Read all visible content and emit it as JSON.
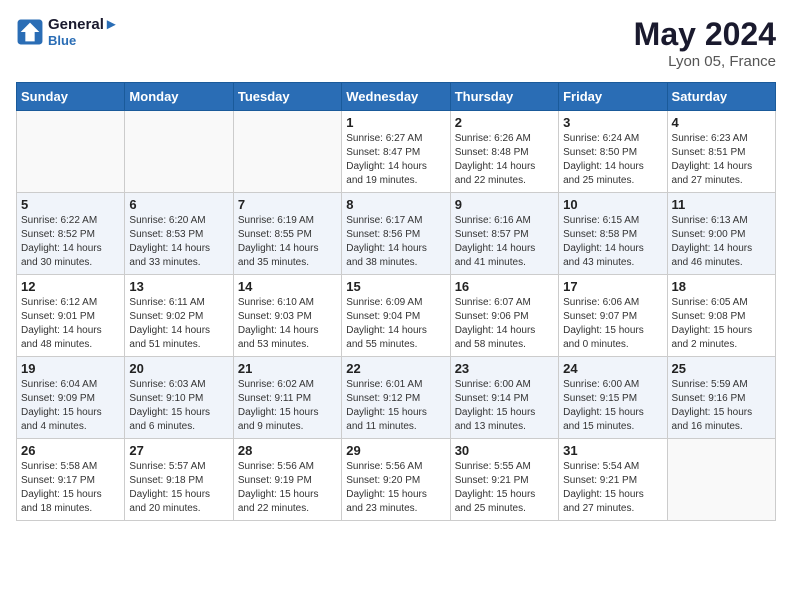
{
  "header": {
    "logo_line1": "General",
    "logo_line2": "Blue",
    "month": "May 2024",
    "location": "Lyon 05, France"
  },
  "weekdays": [
    "Sunday",
    "Monday",
    "Tuesday",
    "Wednesday",
    "Thursday",
    "Friday",
    "Saturday"
  ],
  "rows": [
    [
      {
        "day": "",
        "info": ""
      },
      {
        "day": "",
        "info": ""
      },
      {
        "day": "",
        "info": ""
      },
      {
        "day": "1",
        "info": "Sunrise: 6:27 AM\nSunset: 8:47 PM\nDaylight: 14 hours\nand 19 minutes."
      },
      {
        "day": "2",
        "info": "Sunrise: 6:26 AM\nSunset: 8:48 PM\nDaylight: 14 hours\nand 22 minutes."
      },
      {
        "day": "3",
        "info": "Sunrise: 6:24 AM\nSunset: 8:50 PM\nDaylight: 14 hours\nand 25 minutes."
      },
      {
        "day": "4",
        "info": "Sunrise: 6:23 AM\nSunset: 8:51 PM\nDaylight: 14 hours\nand 27 minutes."
      }
    ],
    [
      {
        "day": "5",
        "info": "Sunrise: 6:22 AM\nSunset: 8:52 PM\nDaylight: 14 hours\nand 30 minutes."
      },
      {
        "day": "6",
        "info": "Sunrise: 6:20 AM\nSunset: 8:53 PM\nDaylight: 14 hours\nand 33 minutes."
      },
      {
        "day": "7",
        "info": "Sunrise: 6:19 AM\nSunset: 8:55 PM\nDaylight: 14 hours\nand 35 minutes."
      },
      {
        "day": "8",
        "info": "Sunrise: 6:17 AM\nSunset: 8:56 PM\nDaylight: 14 hours\nand 38 minutes."
      },
      {
        "day": "9",
        "info": "Sunrise: 6:16 AM\nSunset: 8:57 PM\nDaylight: 14 hours\nand 41 minutes."
      },
      {
        "day": "10",
        "info": "Sunrise: 6:15 AM\nSunset: 8:58 PM\nDaylight: 14 hours\nand 43 minutes."
      },
      {
        "day": "11",
        "info": "Sunrise: 6:13 AM\nSunset: 9:00 PM\nDaylight: 14 hours\nand 46 minutes."
      }
    ],
    [
      {
        "day": "12",
        "info": "Sunrise: 6:12 AM\nSunset: 9:01 PM\nDaylight: 14 hours\nand 48 minutes."
      },
      {
        "day": "13",
        "info": "Sunrise: 6:11 AM\nSunset: 9:02 PM\nDaylight: 14 hours\nand 51 minutes."
      },
      {
        "day": "14",
        "info": "Sunrise: 6:10 AM\nSunset: 9:03 PM\nDaylight: 14 hours\nand 53 minutes."
      },
      {
        "day": "15",
        "info": "Sunrise: 6:09 AM\nSunset: 9:04 PM\nDaylight: 14 hours\nand 55 minutes."
      },
      {
        "day": "16",
        "info": "Sunrise: 6:07 AM\nSunset: 9:06 PM\nDaylight: 14 hours\nand 58 minutes."
      },
      {
        "day": "17",
        "info": "Sunrise: 6:06 AM\nSunset: 9:07 PM\nDaylight: 15 hours\nand 0 minutes."
      },
      {
        "day": "18",
        "info": "Sunrise: 6:05 AM\nSunset: 9:08 PM\nDaylight: 15 hours\nand 2 minutes."
      }
    ],
    [
      {
        "day": "19",
        "info": "Sunrise: 6:04 AM\nSunset: 9:09 PM\nDaylight: 15 hours\nand 4 minutes."
      },
      {
        "day": "20",
        "info": "Sunrise: 6:03 AM\nSunset: 9:10 PM\nDaylight: 15 hours\nand 6 minutes."
      },
      {
        "day": "21",
        "info": "Sunrise: 6:02 AM\nSunset: 9:11 PM\nDaylight: 15 hours\nand 9 minutes."
      },
      {
        "day": "22",
        "info": "Sunrise: 6:01 AM\nSunset: 9:12 PM\nDaylight: 15 hours\nand 11 minutes."
      },
      {
        "day": "23",
        "info": "Sunrise: 6:00 AM\nSunset: 9:14 PM\nDaylight: 15 hours\nand 13 minutes."
      },
      {
        "day": "24",
        "info": "Sunrise: 6:00 AM\nSunset: 9:15 PM\nDaylight: 15 hours\nand 15 minutes."
      },
      {
        "day": "25",
        "info": "Sunrise: 5:59 AM\nSunset: 9:16 PM\nDaylight: 15 hours\nand 16 minutes."
      }
    ],
    [
      {
        "day": "26",
        "info": "Sunrise: 5:58 AM\nSunset: 9:17 PM\nDaylight: 15 hours\nand 18 minutes."
      },
      {
        "day": "27",
        "info": "Sunrise: 5:57 AM\nSunset: 9:18 PM\nDaylight: 15 hours\nand 20 minutes."
      },
      {
        "day": "28",
        "info": "Sunrise: 5:56 AM\nSunset: 9:19 PM\nDaylight: 15 hours\nand 22 minutes."
      },
      {
        "day": "29",
        "info": "Sunrise: 5:56 AM\nSunset: 9:20 PM\nDaylight: 15 hours\nand 23 minutes."
      },
      {
        "day": "30",
        "info": "Sunrise: 5:55 AM\nSunset: 9:21 PM\nDaylight: 15 hours\nand 25 minutes."
      },
      {
        "day": "31",
        "info": "Sunrise: 5:54 AM\nSunset: 9:21 PM\nDaylight: 15 hours\nand 27 minutes."
      },
      {
        "day": "",
        "info": ""
      }
    ]
  ]
}
